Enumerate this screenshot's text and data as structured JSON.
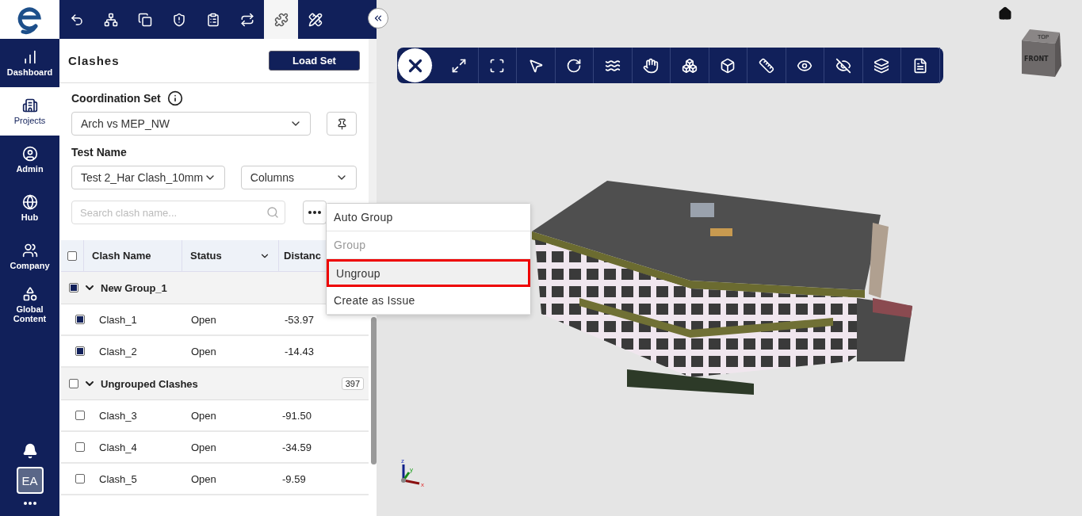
{
  "nav": {
    "items": [
      {
        "label": "Dashboard",
        "selected": false
      },
      {
        "label": "Projects",
        "selected": true
      },
      {
        "label": "Admin",
        "selected": false
      },
      {
        "label": "Hub",
        "selected": false
      },
      {
        "label": "Company",
        "selected": false
      },
      {
        "label": "Global Content",
        "selected": false
      }
    ],
    "avatar": "EA"
  },
  "module_tabs": [
    {
      "selected": false
    },
    {
      "selected": false
    },
    {
      "selected": false
    },
    {
      "selected": false
    },
    {
      "selected": false
    },
    {
      "selected": false
    },
    {
      "selected": true
    },
    {
      "selected": false
    }
  ],
  "panel": {
    "title": "Clashes",
    "load_button": "Load Set",
    "coordination_label": "Coordination Set",
    "coordination_value": "Arch vs MEP_NW",
    "test_label": "Test Name",
    "test_value": "Test 2_Har Clash_10mm",
    "columns_value": "Columns",
    "search": {
      "placeholder": "Search clash name..."
    },
    "table": {
      "all_checked": false,
      "columns": [
        "Clash Name",
        "Status",
        "Distanc"
      ],
      "groups": [
        {
          "name": "New Group_1",
          "checked": true,
          "expanded": true,
          "rows": [
            {
              "name": "Clash_1",
              "status": "Open",
              "distance": "-53.97",
              "checked": true
            },
            {
              "name": "Clash_2",
              "status": "Open",
              "distance": "-14.43",
              "checked": true
            }
          ]
        },
        {
          "name": "Ungrouped Clashes",
          "checked": false,
          "expanded": true,
          "count": "397",
          "rows": [
            {
              "name": "Clash_3",
              "status": "Open",
              "distance": "-91.50",
              "checked": false
            },
            {
              "name": "Clash_4",
              "status": "Open",
              "distance": "-34.59",
              "checked": false
            },
            {
              "name": "Clash_5",
              "status": "Open",
              "distance": "-9.59",
              "checked": false
            }
          ]
        }
      ]
    }
  },
  "menu": {
    "items": [
      {
        "label": "Auto Group",
        "disabled": false,
        "highlighted": false
      },
      {
        "label": "Group",
        "disabled": true,
        "highlighted": false
      },
      {
        "label": "Ungroup",
        "disabled": false,
        "highlighted": true
      },
      {
        "label": "Create as Issue",
        "disabled": false,
        "highlighted": false
      }
    ]
  },
  "viewer": {
    "cube": {
      "top": "TOP",
      "front": "FRONT"
    },
    "axes": {
      "x": "x",
      "y": "y",
      "z": "z"
    }
  }
}
